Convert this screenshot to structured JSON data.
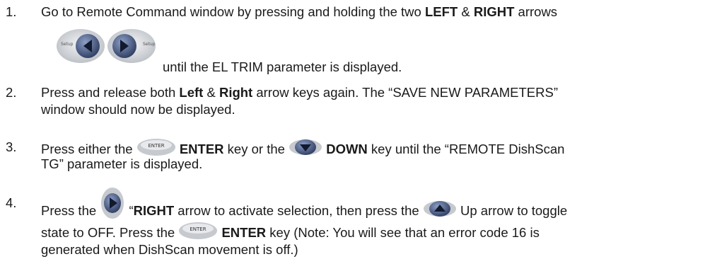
{
  "colors": {
    "text": "#1a1a1a",
    "key_face": "#c9ccd0",
    "key_dark": "#3d4f78",
    "key_arrow": "#1f2a44"
  },
  "step1": {
    "num": "1.",
    "t1": "Go to Remote Command window by pressing and holding the two ",
    "b1": "LEFT",
    "t2": " & ",
    "b2": "RIGHT",
    "t3": " arrows",
    "t4": "until the EL TRIM parameter is displayed.",
    "setup_label": "Setup",
    "keys": [
      "setup-left-key-icon",
      "setup-right-key-icon"
    ]
  },
  "step2": {
    "num": "2.",
    "t1": "Press and release both ",
    "b1": "Left",
    "t2": " & ",
    "b2": "Right",
    "t3": " arrow keys again.  The “SAVE NEW PARAMETERS”",
    "t4": "window should now be displayed."
  },
  "step3": {
    "num": "3.",
    "t1": "Press either the ",
    "enter_label": "ENTER",
    "b1": "ENTER",
    "t2": " key or the ",
    "b2": "DOWN",
    "t3": " key until the “REMOTE DishScan",
    "t4": "TG” parameter is displayed."
  },
  "step4": {
    "num": "4.",
    "t1": "Press the ",
    "t2": "“",
    "b1": "RIGHT",
    "t3": " arrow to activate selection, then press the ",
    "t4": " Up arrow to toggle",
    "t5": "state to OFF.  Press the ",
    "enter_label": "ENTER",
    "b2": "ENTER",
    "t6": " key (Note: You will see that an error code 16 is",
    "t7": "generated when DishScan movement is off.)"
  }
}
